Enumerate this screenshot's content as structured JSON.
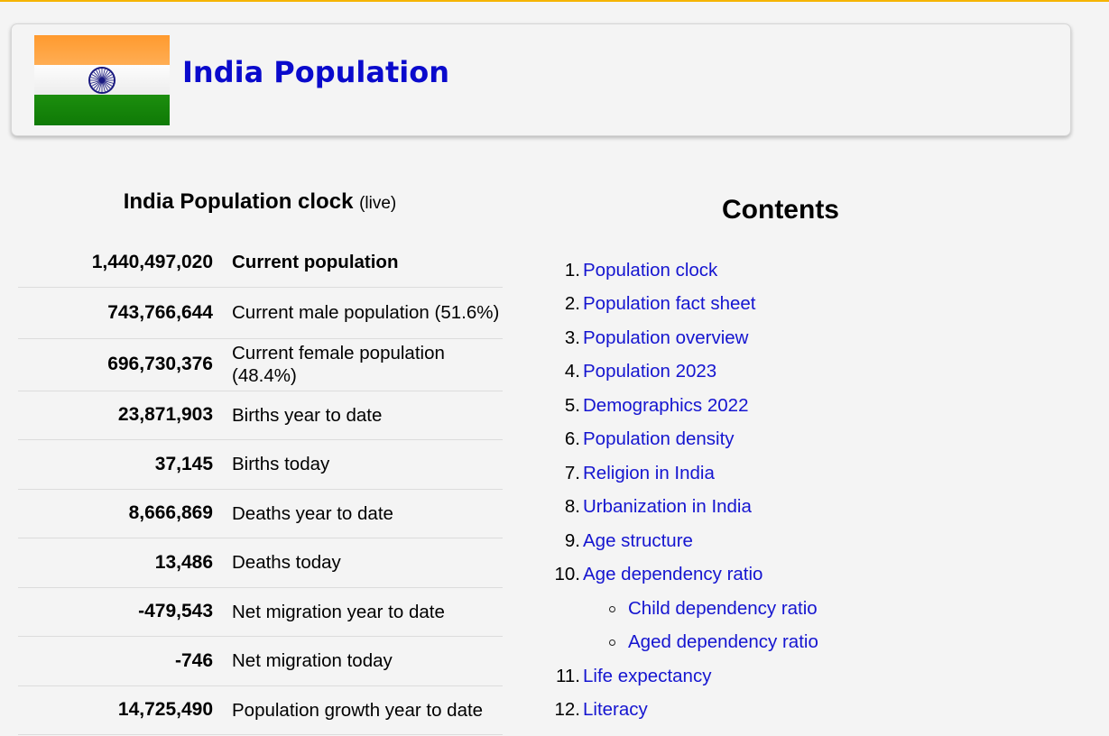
{
  "header": {
    "title": "India Population"
  },
  "clock": {
    "heading": "India Population clock",
    "heading_suffix": "(live)",
    "rows": [
      {
        "value": "1,440,497,020",
        "label": "Current population",
        "bold": true
      },
      {
        "value": "743,766,644",
        "label": "Current male population (51.6%)"
      },
      {
        "value": "696,730,376",
        "label": "Current female population (48.4%)"
      },
      {
        "value": "23,871,903",
        "label": "Births year to date"
      },
      {
        "value": "37,145",
        "label": "Births today"
      },
      {
        "value": "8,666,869",
        "label": "Deaths year to date"
      },
      {
        "value": "13,486",
        "label": "Deaths today"
      },
      {
        "value": "-479,543",
        "label": "Net migration year to date"
      },
      {
        "value": "-746",
        "label": "Net migration today"
      },
      {
        "value": "14,725,490",
        "label": "Population growth year to date"
      }
    ]
  },
  "contents": {
    "title": "Contents",
    "items": [
      {
        "num": "1.",
        "label": "Population clock"
      },
      {
        "num": "2.",
        "label": "Population fact sheet"
      },
      {
        "num": "3.",
        "label": "Population overview"
      },
      {
        "num": "4.",
        "label": "Population 2023"
      },
      {
        "num": "5.",
        "label": "Demographics 2022"
      },
      {
        "num": "6.",
        "label": "Population density"
      },
      {
        "num": "7.",
        "label": "Religion in India"
      },
      {
        "num": "8.",
        "label": "Urbanization in India"
      },
      {
        "num": "9.",
        "label": "Age structure"
      },
      {
        "num": "10.",
        "label": "Age dependency ratio"
      },
      {
        "num": "",
        "label": "Child dependency ratio",
        "sub": true
      },
      {
        "num": "",
        "label": "Aged dependency ratio",
        "sub": true
      },
      {
        "num": "11.",
        "label": "Life expectancy"
      },
      {
        "num": "12.",
        "label": "Literacy"
      }
    ]
  },
  "colors": {
    "accent_rule": "#f5b400",
    "link": "#1515d0",
    "title": "#0a0acc",
    "flag_saffron": "#ff9933",
    "flag_white": "#ffffff",
    "flag_green": "#138808",
    "chakra": "#000080"
  }
}
